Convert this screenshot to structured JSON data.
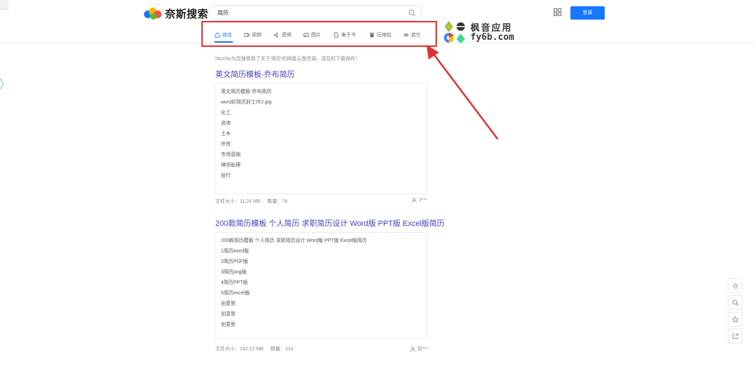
{
  "brand": {
    "logo_text": "奈斯搜索"
  },
  "search": {
    "value": "简历"
  },
  "tabs": [
    {
      "label": "综合",
      "icon": "home-icon",
      "active": true
    },
    {
      "label": "视频",
      "icon": "video-icon"
    },
    {
      "label": "音频",
      "icon": "audio-icon"
    },
    {
      "label": "图片",
      "icon": "image-icon"
    },
    {
      "label": "电子书",
      "icon": "ebook-icon"
    },
    {
      "label": "压缩包",
      "icon": "archive-icon"
    },
    {
      "label": "其它",
      "icon": "other-icon"
    }
  ],
  "header": {
    "login_label": "登录"
  },
  "watermark": {
    "top": "枫音应用",
    "bottom": "fy6b.com"
  },
  "notice": "NiceSo为您搜索到了关于'简历'的网盘云盘资源，请及时下载保存！",
  "results": [
    {
      "title": "英文简历模板-乔布简历",
      "lines": [
        "英文简历模板-乔布简历",
        "word好简历好工作2.jpg",
        "化工",
        "咨询",
        "土木",
        "外贸",
        "市场营销",
        "律师助理",
        "投行"
      ],
      "size_label": "文件大小：11.24 MB",
      "count_label": "数量：74",
      "owner": "J***"
    },
    {
      "title": "200款简历模板 个人简历 求职简历设计 Word版 PPT版 Excel版简历",
      "lines": [
        "200款简历模板 个人简历 求职简历设计 Word版 PPT版 Excel版简历",
        "1简历word版",
        "2简历PDF版",
        "3简历png版",
        "4简历PPT版",
        "5简历excel版",
        "创意型",
        "创意型",
        "创意型"
      ],
      "size_label": "文件大小：242.12 MB",
      "count_label": "数量：314",
      "owner": "风***"
    }
  ],
  "colors": {
    "accent": "#1677ff",
    "highlight_box": "#e03131",
    "title_link": "#3f3fbe"
  }
}
